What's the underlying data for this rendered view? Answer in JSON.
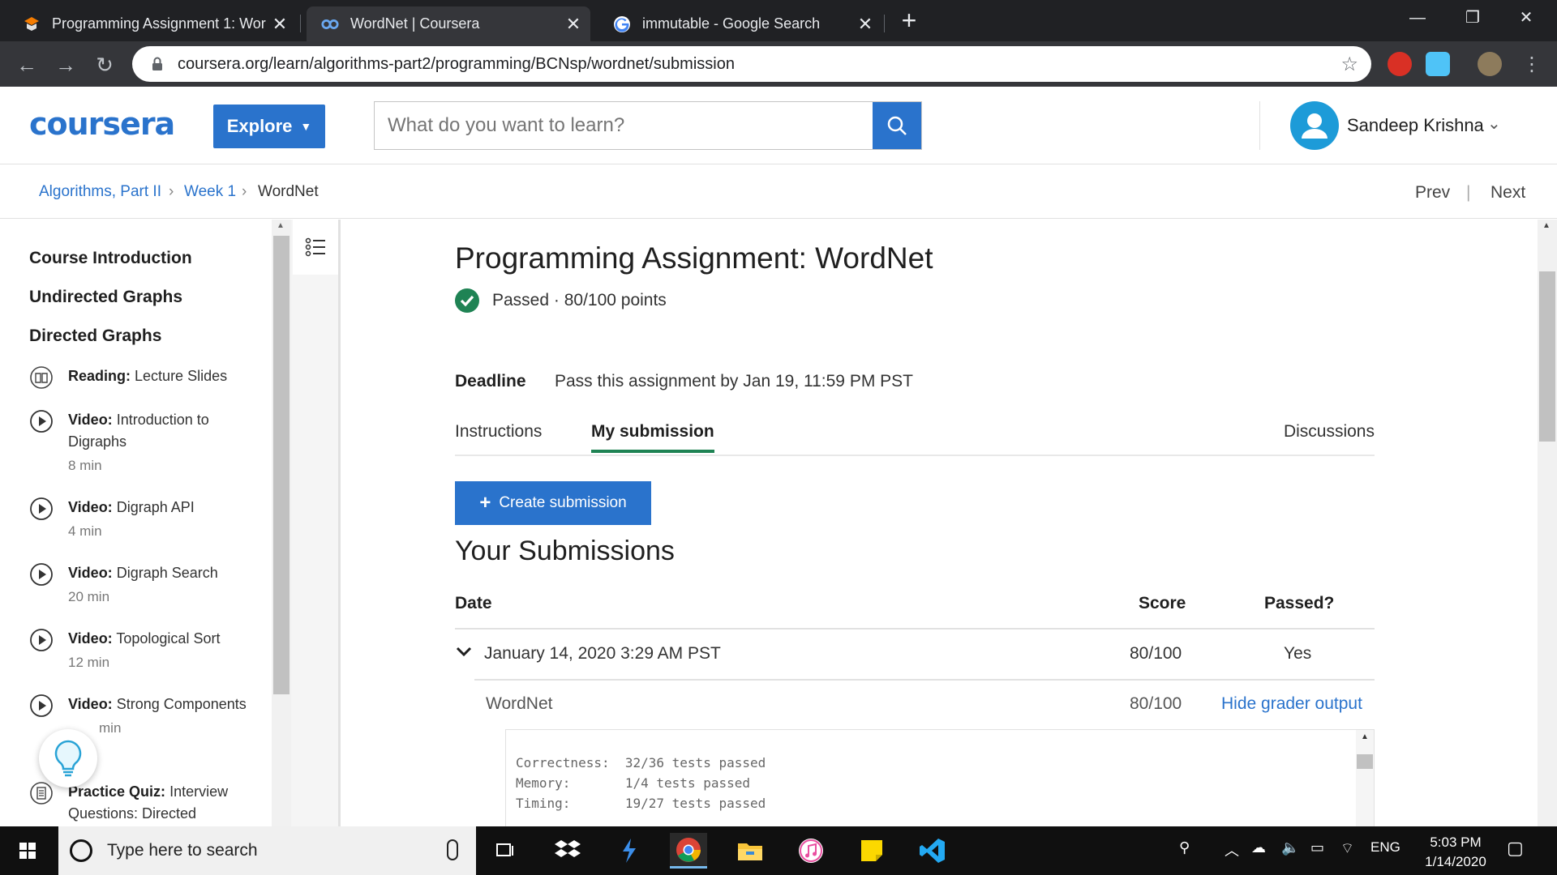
{
  "browser": {
    "tabs": [
      {
        "title": "Programming Assignment 1: Wor",
        "active": false
      },
      {
        "title": "WordNet | Coursera",
        "active": true
      },
      {
        "title": "immutable - Google Search",
        "active": false
      }
    ],
    "url": "coursera.org/learn/algorithms-part2/programming/BCNsp/wordnet/submission"
  },
  "header": {
    "logo": "coursera",
    "explore_label": "Explore",
    "search_placeholder": "What do you want to learn?",
    "user_name": "Sandeep Krishna"
  },
  "breadcrumb": {
    "items": [
      "Algorithms, Part II",
      "Week 1",
      "WordNet"
    ],
    "prev": "Prev",
    "next": "Next",
    "divider": "|"
  },
  "sidebar": {
    "sections": [
      "Course Introduction",
      "Undirected Graphs",
      "Directed Graphs"
    ],
    "items": [
      {
        "type": "Reading:",
        "title": "Lecture Slides",
        "duration": "",
        "icon": "book-icon"
      },
      {
        "type": "Video:",
        "title": "Introduction to Digraphs",
        "duration": "8 min",
        "icon": "play-icon"
      },
      {
        "type": "Video:",
        "title": "Digraph API",
        "duration": "4 min",
        "icon": "play-icon"
      },
      {
        "type": "Video:",
        "title": "Digraph Search",
        "duration": "20 min",
        "icon": "play-icon"
      },
      {
        "type": "Video:",
        "title": "Topological Sort",
        "duration": "12 min",
        "icon": "play-icon"
      },
      {
        "type": "Video:",
        "title": "Strong Components",
        "duration": "min",
        "icon": "play-icon"
      },
      {
        "type": "Practice Quiz:",
        "title": "Interview Questions: Directed",
        "duration": "",
        "icon": "quiz-icon"
      }
    ]
  },
  "assignment": {
    "title": "Programming Assignment: WordNet",
    "status": "Passed · 80/100 points",
    "deadline_label": "Deadline",
    "deadline_text": "Pass this assignment by Jan 19, 11:59 PM PST",
    "tabs": [
      "Instructions",
      "My submission",
      "Discussions"
    ],
    "active_tab": "My submission",
    "create_button": "Create submission",
    "submissions_title": "Your Submissions",
    "table_headers": {
      "date": "Date",
      "score": "Score",
      "passed": "Passed?"
    },
    "submissions": [
      {
        "date": "January 14, 2020 3:29 AM PST",
        "score": "80/100",
        "passed": "Yes"
      }
    ],
    "part": {
      "name": "WordNet",
      "score": "80/100",
      "link": "Hide grader output"
    },
    "grader_output": [
      {
        "label": "Correctness:",
        "value": "32/36 tests passed"
      },
      {
        "label": "Memory:",
        "value": "1/4 tests passed"
      },
      {
        "label": "Timing:",
        "value": "19/27 tests passed"
      }
    ]
  },
  "taskbar": {
    "search_placeholder": "Type here to search",
    "language": "ENG",
    "time": "5:03 PM",
    "date": "1/14/2020"
  },
  "colors": {
    "brand": "#2a73cc",
    "success": "#1f8354",
    "chrome_dark": "#202124"
  }
}
